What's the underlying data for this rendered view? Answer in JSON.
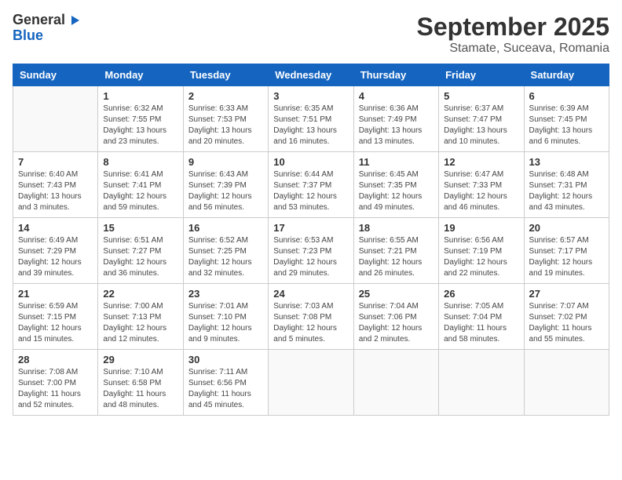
{
  "logo": {
    "general": "General",
    "blue": "Blue"
  },
  "header": {
    "month": "September 2025",
    "location": "Stamate, Suceava, Romania"
  },
  "weekdays": [
    "Sunday",
    "Monday",
    "Tuesday",
    "Wednesday",
    "Thursday",
    "Friday",
    "Saturday"
  ],
  "weeks": [
    [
      {
        "day": "",
        "empty": true
      },
      {
        "day": "1",
        "sunrise": "Sunrise: 6:32 AM",
        "sunset": "Sunset: 7:55 PM",
        "daylight": "Daylight: 13 hours and 23 minutes."
      },
      {
        "day": "2",
        "sunrise": "Sunrise: 6:33 AM",
        "sunset": "Sunset: 7:53 PM",
        "daylight": "Daylight: 13 hours and 20 minutes."
      },
      {
        "day": "3",
        "sunrise": "Sunrise: 6:35 AM",
        "sunset": "Sunset: 7:51 PM",
        "daylight": "Daylight: 13 hours and 16 minutes."
      },
      {
        "day": "4",
        "sunrise": "Sunrise: 6:36 AM",
        "sunset": "Sunset: 7:49 PM",
        "daylight": "Daylight: 13 hours and 13 minutes."
      },
      {
        "day": "5",
        "sunrise": "Sunrise: 6:37 AM",
        "sunset": "Sunset: 7:47 PM",
        "daylight": "Daylight: 13 hours and 10 minutes."
      },
      {
        "day": "6",
        "sunrise": "Sunrise: 6:39 AM",
        "sunset": "Sunset: 7:45 PM",
        "daylight": "Daylight: 13 hours and 6 minutes."
      }
    ],
    [
      {
        "day": "7",
        "sunrise": "Sunrise: 6:40 AM",
        "sunset": "Sunset: 7:43 PM",
        "daylight": "Daylight: 13 hours and 3 minutes."
      },
      {
        "day": "8",
        "sunrise": "Sunrise: 6:41 AM",
        "sunset": "Sunset: 7:41 PM",
        "daylight": "Daylight: 12 hours and 59 minutes."
      },
      {
        "day": "9",
        "sunrise": "Sunrise: 6:43 AM",
        "sunset": "Sunset: 7:39 PM",
        "daylight": "Daylight: 12 hours and 56 minutes."
      },
      {
        "day": "10",
        "sunrise": "Sunrise: 6:44 AM",
        "sunset": "Sunset: 7:37 PM",
        "daylight": "Daylight: 12 hours and 53 minutes."
      },
      {
        "day": "11",
        "sunrise": "Sunrise: 6:45 AM",
        "sunset": "Sunset: 7:35 PM",
        "daylight": "Daylight: 12 hours and 49 minutes."
      },
      {
        "day": "12",
        "sunrise": "Sunrise: 6:47 AM",
        "sunset": "Sunset: 7:33 PM",
        "daylight": "Daylight: 12 hours and 46 minutes."
      },
      {
        "day": "13",
        "sunrise": "Sunrise: 6:48 AM",
        "sunset": "Sunset: 7:31 PM",
        "daylight": "Daylight: 12 hours and 43 minutes."
      }
    ],
    [
      {
        "day": "14",
        "sunrise": "Sunrise: 6:49 AM",
        "sunset": "Sunset: 7:29 PM",
        "daylight": "Daylight: 12 hours and 39 minutes."
      },
      {
        "day": "15",
        "sunrise": "Sunrise: 6:51 AM",
        "sunset": "Sunset: 7:27 PM",
        "daylight": "Daylight: 12 hours and 36 minutes."
      },
      {
        "day": "16",
        "sunrise": "Sunrise: 6:52 AM",
        "sunset": "Sunset: 7:25 PM",
        "daylight": "Daylight: 12 hours and 32 minutes."
      },
      {
        "day": "17",
        "sunrise": "Sunrise: 6:53 AM",
        "sunset": "Sunset: 7:23 PM",
        "daylight": "Daylight: 12 hours and 29 minutes."
      },
      {
        "day": "18",
        "sunrise": "Sunrise: 6:55 AM",
        "sunset": "Sunset: 7:21 PM",
        "daylight": "Daylight: 12 hours and 26 minutes."
      },
      {
        "day": "19",
        "sunrise": "Sunrise: 6:56 AM",
        "sunset": "Sunset: 7:19 PM",
        "daylight": "Daylight: 12 hours and 22 minutes."
      },
      {
        "day": "20",
        "sunrise": "Sunrise: 6:57 AM",
        "sunset": "Sunset: 7:17 PM",
        "daylight": "Daylight: 12 hours and 19 minutes."
      }
    ],
    [
      {
        "day": "21",
        "sunrise": "Sunrise: 6:59 AM",
        "sunset": "Sunset: 7:15 PM",
        "daylight": "Daylight: 12 hours and 15 minutes."
      },
      {
        "day": "22",
        "sunrise": "Sunrise: 7:00 AM",
        "sunset": "Sunset: 7:13 PM",
        "daylight": "Daylight: 12 hours and 12 minutes."
      },
      {
        "day": "23",
        "sunrise": "Sunrise: 7:01 AM",
        "sunset": "Sunset: 7:10 PM",
        "daylight": "Daylight: 12 hours and 9 minutes."
      },
      {
        "day": "24",
        "sunrise": "Sunrise: 7:03 AM",
        "sunset": "Sunset: 7:08 PM",
        "daylight": "Daylight: 12 hours and 5 minutes."
      },
      {
        "day": "25",
        "sunrise": "Sunrise: 7:04 AM",
        "sunset": "Sunset: 7:06 PM",
        "daylight": "Daylight: 12 hours and 2 minutes."
      },
      {
        "day": "26",
        "sunrise": "Sunrise: 7:05 AM",
        "sunset": "Sunset: 7:04 PM",
        "daylight": "Daylight: 11 hours and 58 minutes."
      },
      {
        "day": "27",
        "sunrise": "Sunrise: 7:07 AM",
        "sunset": "Sunset: 7:02 PM",
        "daylight": "Daylight: 11 hours and 55 minutes."
      }
    ],
    [
      {
        "day": "28",
        "sunrise": "Sunrise: 7:08 AM",
        "sunset": "Sunset: 7:00 PM",
        "daylight": "Daylight: 11 hours and 52 minutes."
      },
      {
        "day": "29",
        "sunrise": "Sunrise: 7:10 AM",
        "sunset": "Sunset: 6:58 PM",
        "daylight": "Daylight: 11 hours and 48 minutes."
      },
      {
        "day": "30",
        "sunrise": "Sunrise: 7:11 AM",
        "sunset": "Sunset: 6:56 PM",
        "daylight": "Daylight: 11 hours and 45 minutes."
      },
      {
        "day": "",
        "empty": true
      },
      {
        "day": "",
        "empty": true
      },
      {
        "day": "",
        "empty": true
      },
      {
        "day": "",
        "empty": true
      }
    ]
  ]
}
